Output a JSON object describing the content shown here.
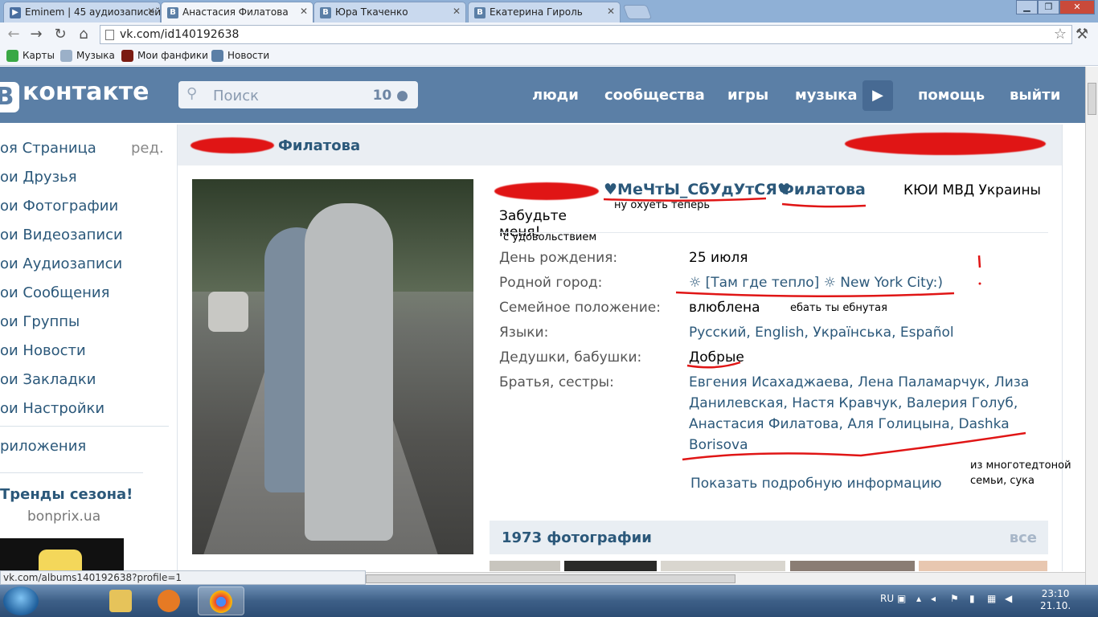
{
  "browser": {
    "tabs": [
      {
        "label": "Eminem | 45 аудиозаписей",
        "icon": "play-icon"
      },
      {
        "label": "Анастасия Филатова",
        "icon": "vk-icon",
        "active": true
      },
      {
        "label": "Юра Ткаченко",
        "icon": "vk-icon"
      },
      {
        "label": "Екатерина Гироль",
        "icon": "vk-icon"
      }
    ],
    "url": "vk.com/id140192638",
    "bookmarks": [
      "Карты",
      "Музыка",
      "Мои фанфики",
      "Новости"
    ],
    "status_url": "vk.com/albums140192638?profile=1"
  },
  "header": {
    "logo": "контакте",
    "search_placeholder": "Поиск",
    "search_count": "10",
    "nav": [
      "люди",
      "сообщества",
      "игры",
      "музыка",
      "помощь",
      "выйти"
    ]
  },
  "menu": {
    "items": [
      "оя Страница",
      "ои Друзья",
      "ои Фотографии",
      "ои Видеозаписи",
      "ои Аудиозаписи",
      "ои Сообщения",
      "ои Группы",
      "ои Новости",
      "ои Закладки",
      "ои Настройки"
    ],
    "edit": "ред.",
    "apps": "риложения",
    "ad_title": "Тренды сезона!",
    "ad_sub": "bonprix.ua"
  },
  "profile": {
    "page_title": "Филатова",
    "name_nick": "♥МеЧтЫ_СбУдУтСЯ♥",
    "name_last": "Филатова",
    "org": "КЮИ МВД Украины",
    "status": "Забудьте меня!",
    "notes": {
      "nickname": "ну охуеть теперь",
      "status": "с удовольствием",
      "relationship": "ебать ты ебнутая",
      "siblings_1": "из многотедтоной",
      "siblings_2": "семьи, сука"
    },
    "fields": [
      {
        "label": "День рождения:",
        "value": "25 июля",
        "plain": true
      },
      {
        "label": "Родной город:",
        "value": "☼ [Там где тепло] ☼ New York City:)"
      },
      {
        "label": "Семейное положение:",
        "value": "влюблена",
        "plain": true
      },
      {
        "label": "Языки:",
        "value": "Русский, English, Українська, Español"
      },
      {
        "label": "Дедушки, бабушки:",
        "value": "Добрые",
        "plain": true
      },
      {
        "label": "Братья, сестры:",
        "value_lines": [
          "Евгения Исахаджаева, Лена Паламарчук, Лиза",
          "Данилевская, Настя Кравчук, Валерия Голуб,",
          "Анастасия Филатова, Аля Голицына, Dashka",
          "Borisova"
        ]
      }
    ],
    "show_more": "Показать подробную информацию",
    "photos_title": "1973 фотографии",
    "photos_all": "все"
  },
  "taskbar": {
    "lang": "RU",
    "time": "23:10",
    "date": "21.10."
  }
}
